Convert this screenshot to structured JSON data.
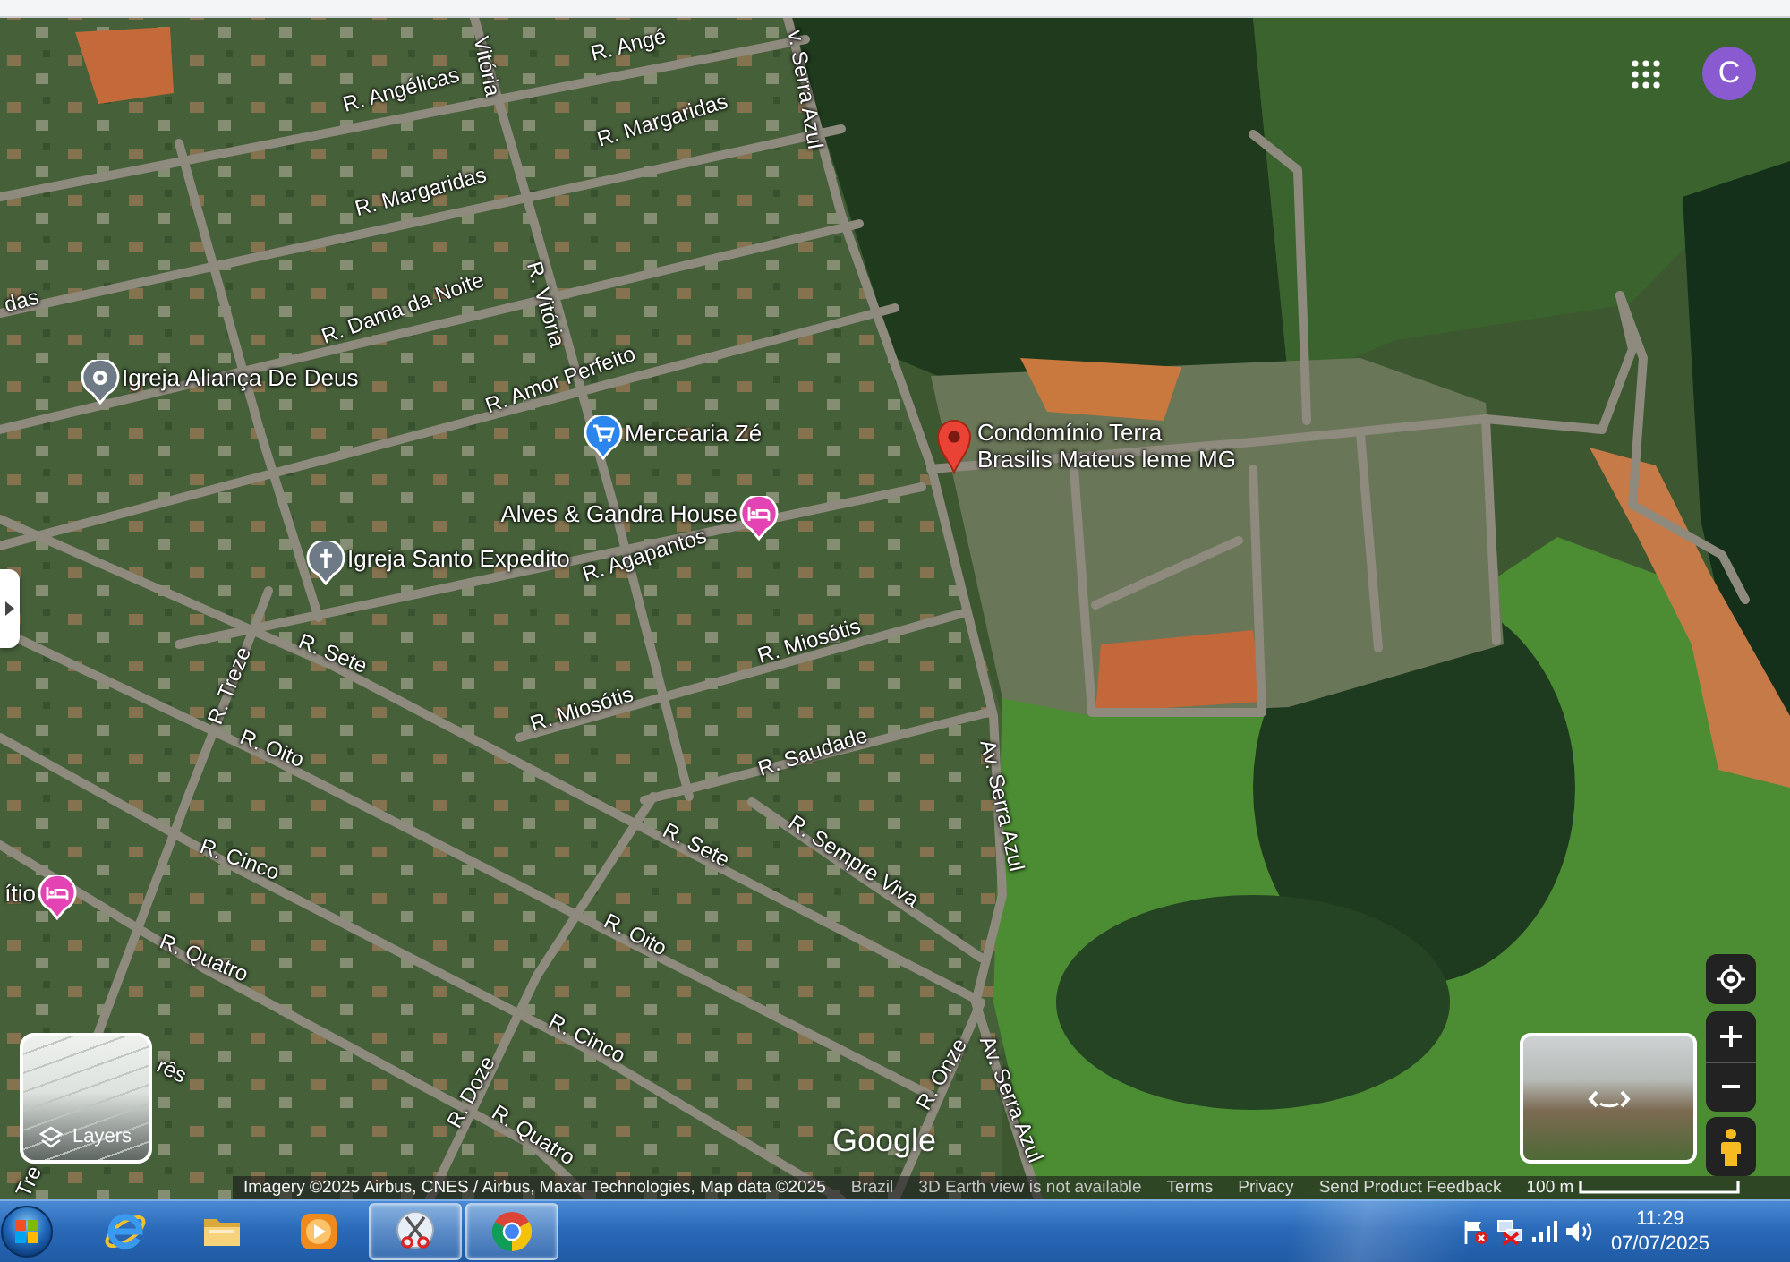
{
  "map": {
    "street_labels": [
      "R. Angé",
      "R. Angélicas",
      "Vitória",
      "v. Serra Azul",
      "R. Margaridas",
      "R. Margaridas",
      "das",
      "R. Dama da Noite",
      "R. Vitória",
      "R. Amor Perfeito",
      "R. Agapantos",
      "R. Miosótis",
      "R. Miosótis",
      "R. Saudade",
      "Av. Serra Azul",
      "R. Sete",
      "R. Treze",
      "R. Oito",
      "R. Cinco",
      "R. Quatro",
      "R. Sete",
      "R. Sempre Viva",
      "R. Oito",
      "R. Cinco",
      "R. Doze",
      "R. Quatro",
      "R. Onze",
      "Av. Serra Azul",
      "rês",
      "Tre"
    ],
    "places": [
      {
        "lines": [
          "Igreja Aliança De Deus"
        ],
        "kind": "place"
      },
      {
        "lines": [
          "Mercearia Zé"
        ],
        "kind": "shop"
      },
      {
        "lines": [
          "Alves & Gandra House"
        ],
        "kind": "hotel"
      },
      {
        "lines": [
          "Igreja Santo Expedito"
        ],
        "kind": "church"
      },
      {
        "lines": [
          "Condomínio Terra",
          "Brasilis Mateus leme MG"
        ],
        "kind": "selected"
      },
      {
        "lines": [
          "ítio"
        ],
        "kind": "hotel"
      }
    ],
    "logo": "Google"
  },
  "account": {
    "initial": "C"
  },
  "layers_button": {
    "label": "Layers"
  },
  "attribution": {
    "imagery": "Imagery ©2025 Airbus, CNES / Airbus, Maxar Technologies, Map data ©2025",
    "region": "Brazil",
    "notice": "3D Earth view is not available",
    "links": [
      "Terms",
      "Privacy",
      "Send Product Feedback"
    ],
    "scale": "100 m"
  },
  "taskbar": {
    "apps": [
      {
        "kind": "internet-explorer",
        "open": false
      },
      {
        "kind": "file-explorer",
        "open": false
      },
      {
        "kind": "media-player",
        "open": false
      },
      {
        "kind": "snipping-tool",
        "open": true
      },
      {
        "kind": "chrome",
        "open": true
      }
    ],
    "clock": {
      "time": "11:29",
      "date": "07/07/2025"
    }
  }
}
